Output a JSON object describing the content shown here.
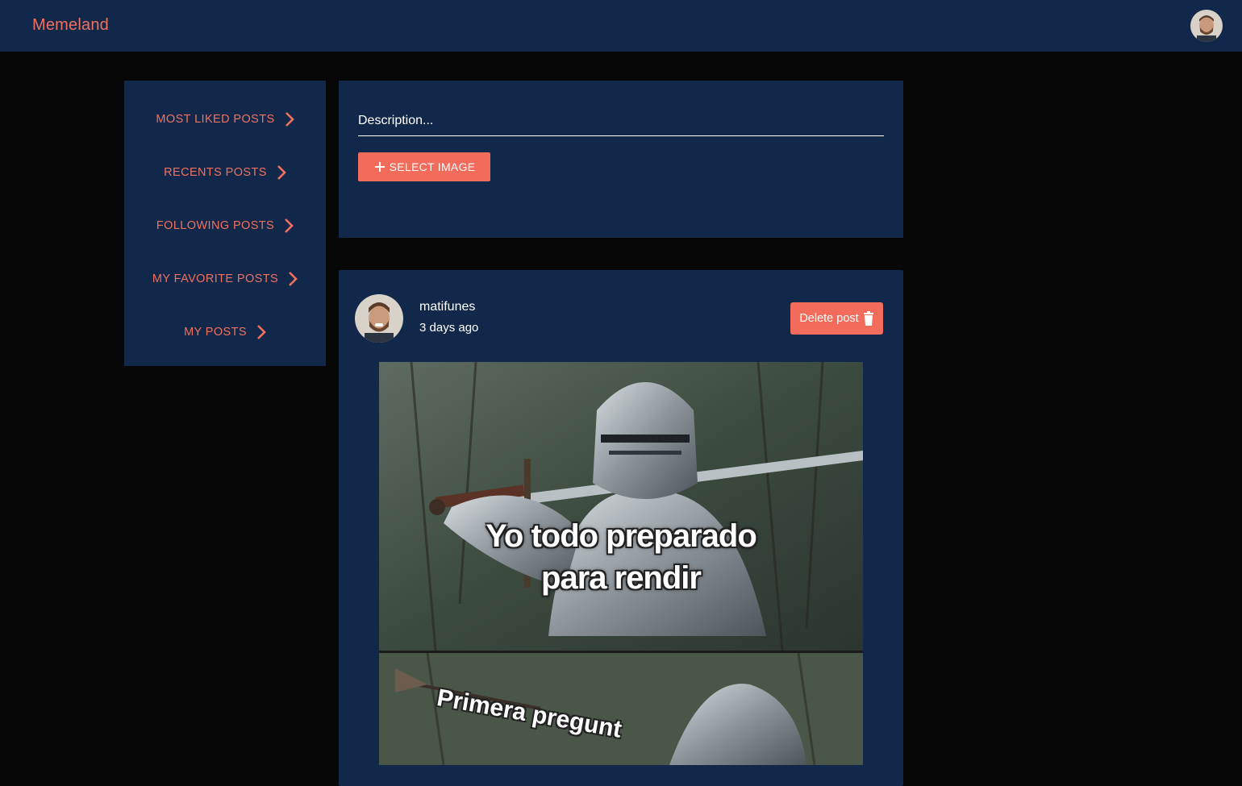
{
  "header": {
    "brand": "Memeland",
    "user_avatar_alt": "user avatar"
  },
  "sidebar": {
    "items": [
      {
        "label": "MOST LIKED POSTS"
      },
      {
        "label": "RECENTS POSTS"
      },
      {
        "label": "FOLLOWING POSTS"
      },
      {
        "label": "MY FAVORITE POSTS"
      },
      {
        "label": "MY POSTS"
      }
    ]
  },
  "composer": {
    "description_placeholder": "Description...",
    "description_value": "",
    "select_image_label": "SELECT IMAGE"
  },
  "post": {
    "username": "matifunes",
    "time_ago": "3 days ago",
    "delete_label": "Delete post",
    "image_caption_line1": "Yo todo preparado",
    "image_caption_line2": "para rendir",
    "image_caption_bottom": "Primera pregunt"
  },
  "colors": {
    "accent": "#f26b5b",
    "panel": "#12284a",
    "background": "#070707"
  },
  "icons": {
    "chevron": "chevron-right-icon",
    "plus": "plus-icon",
    "trash": "trash-icon"
  }
}
